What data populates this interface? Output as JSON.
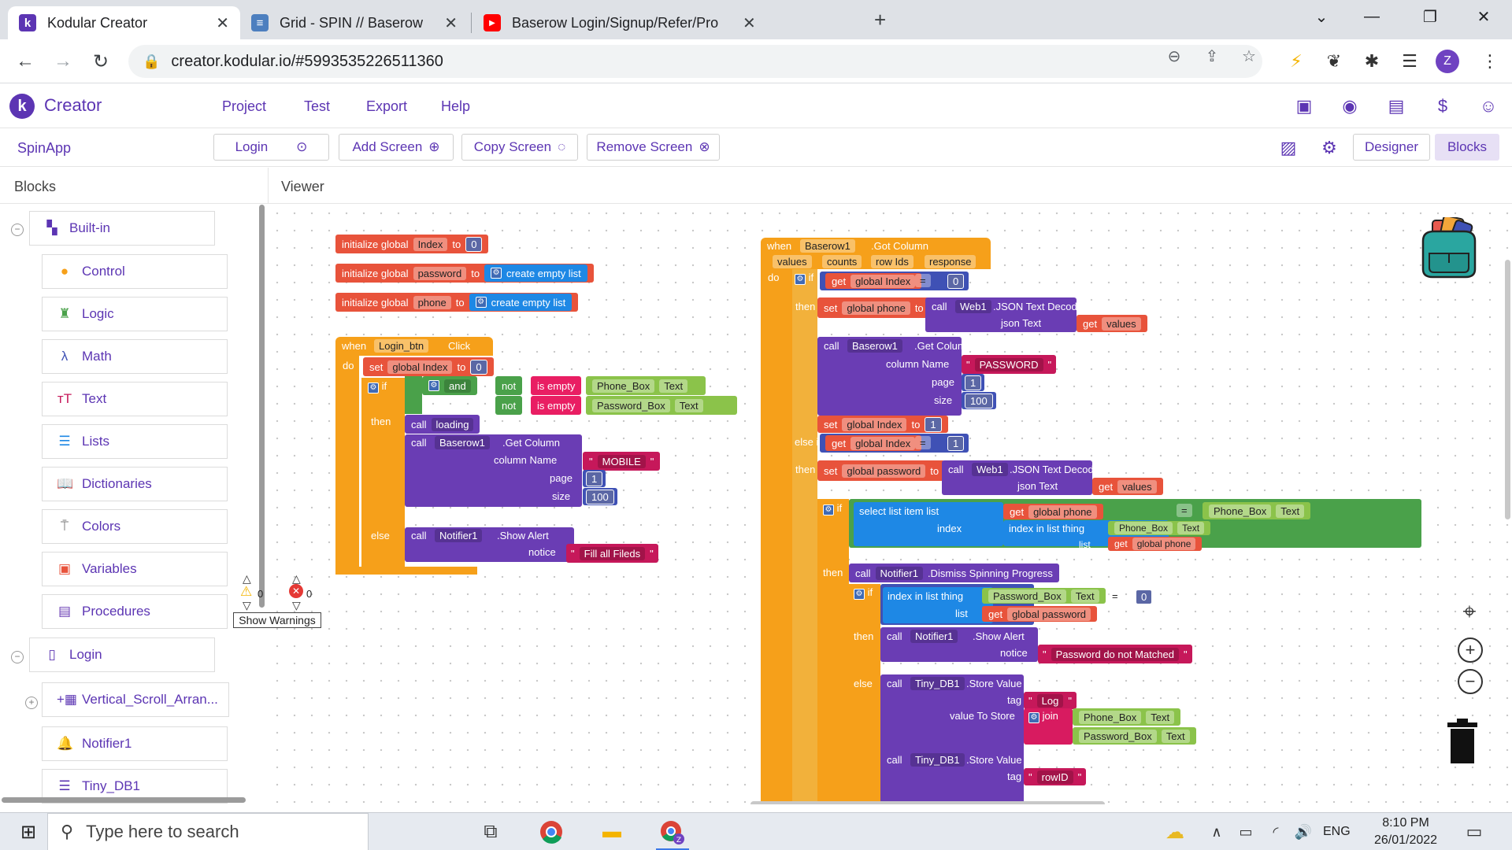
{
  "browser": {
    "tabs": [
      {
        "title": "Kodular Creator",
        "active": true,
        "favicon": "kodular-icon"
      },
      {
        "title": "Grid - SPIN // Baserow",
        "active": false,
        "favicon": "baserow-icon"
      },
      {
        "title": "Baserow Login/Signup/Refer/Pro",
        "active": false,
        "favicon": "youtube-icon"
      }
    ],
    "url": "creator.kodular.io/#5993535226511360",
    "profile_initial": "Z"
  },
  "app": {
    "brand": "Creator",
    "menu": [
      "Project",
      "Test",
      "Export",
      "Help"
    ],
    "project_name": "SpinApp",
    "screen_select": "Login",
    "add_screen": "Add Screen",
    "copy_screen": "Copy Screen",
    "remove_screen": "Remove Screen",
    "designer": "Designer",
    "blocks": "Blocks"
  },
  "panel": {
    "header": "Blocks",
    "viewer": "Viewer",
    "builtin": "Built-in",
    "items": [
      "Control",
      "Logic",
      "Math",
      "Text",
      "Lists",
      "Dictionaries",
      "Colors",
      "Variables",
      "Procedures"
    ],
    "screen": "Login",
    "components": [
      "Vertical_Scroll_Arran...",
      "Notifier1",
      "Tiny_DB1"
    ]
  },
  "colors": {
    "control": "#f6a01a",
    "logic": "#4aa14a",
    "math": "#5b67a5",
    "text": "#c6185a",
    "lists": "#1e88e5",
    "variables": "#e8533b",
    "component": "#6a3db4",
    "accent": "#5c35b3"
  },
  "blocks": {
    "init_index": {
      "kw": "initialize global",
      "name": "Index",
      "to": "to",
      "value": "0"
    },
    "init_password": {
      "kw": "initialize global",
      "name": "password",
      "to": "to",
      "value": "create empty list"
    },
    "init_phone": {
      "kw": "initialize global",
      "name": "phone",
      "to": "to",
      "value": "create empty list"
    },
    "login_event": {
      "when": "when",
      "component": "Login_btn",
      "event": "Click",
      "do": "do",
      "set": "set",
      "var": "global Index",
      "to": "to",
      "set_value": "0",
      "if": "if",
      "and": "and",
      "not": "not",
      "is_empty": "is empty",
      "phone_box": "Phone_Box",
      "password_box": "Password_Box",
      "text": "Text",
      "then": "then",
      "call": "call",
      "loading": "loading",
      "baserow": "Baserow1",
      "get_column": ".Get Column",
      "column_name": "column Name",
      "mobile": "MOBILE",
      "page": "page",
      "page_value": "1",
      "size": "size",
      "size_value": "100",
      "else": "else",
      "notifier": "Notifier1",
      "show_alert": ".Show Alert",
      "notice": "notice",
      "notice_value": "Fill all Fileds"
    },
    "got_column": {
      "when": "when",
      "component": "Baserow1",
      "event": ".Got Column",
      "params": [
        "values",
        "counts",
        "row Ids",
        "response"
      ],
      "do": "do",
      "if": "if",
      "get": "get",
      "global_index": "global Index",
      "eq": "=",
      "zero": "0",
      "one": "1",
      "then": "then",
      "set": "set",
      "global_phone": "global phone",
      "to": "to",
      "call": "call",
      "web": "Web1",
      "json_decode": ".JSON Text Decode",
      "json_text": "json Text",
      "values": "values",
      "baserow": "Baserow1",
      "get_column": ".Get Column",
      "column_name": "column Name",
      "password_col": "PASSWORD",
      "page": "page",
      "size": "size",
      "size_value": "100",
      "else_if": "else if",
      "global_password": "global password",
      "select_list_item": "select list item",
      "list": "list",
      "index": "index",
      "index_in_list": "index in list",
      "thing": "thing",
      "phone_box": "Phone_Box",
      "password_box": "Password_Box",
      "text": "Text",
      "notifier": "Notifier1",
      "dismiss": ".Dismiss Spinning Progress",
      "show_alert": ".Show Alert",
      "notice": "notice",
      "not_matched": "Password do not Matched",
      "else": "else",
      "tinydb": "Tiny_DB1",
      "store_value": ".Store Value",
      "tag": "tag",
      "log": "Log",
      "value_to_store": "value To Store",
      "join": "join",
      "rowid": "rowID"
    }
  },
  "warnings": {
    "warn_count": "0",
    "error_count": "0",
    "button": "Show Warnings"
  },
  "taskbar": {
    "search_placeholder": "Type here to search",
    "lang": "ENG",
    "time": "8:10 PM",
    "date": "26/01/2022"
  }
}
